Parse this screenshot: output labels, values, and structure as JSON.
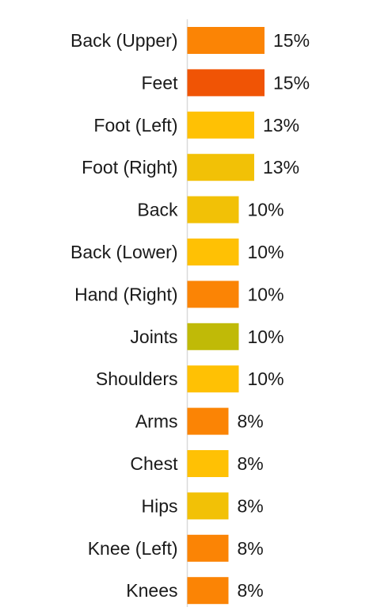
{
  "chart_data": {
    "type": "bar",
    "orientation": "horizontal",
    "categories": [
      "Back (Upper)",
      "Feet",
      "Foot (Left)",
      "Foot (Right)",
      "Back",
      "Back (Lower)",
      "Hand (Right)",
      "Joints",
      "Shoulders",
      "Arms",
      "Chest",
      "Hips",
      "Knee (Left)",
      "Knees"
    ],
    "values": [
      15,
      15,
      13,
      13,
      10,
      10,
      10,
      10,
      10,
      8,
      8,
      8,
      8,
      8
    ],
    "value_labels": [
      "15%",
      "15%",
      "13%",
      "13%",
      "10%",
      "10%",
      "10%",
      "10%",
      "10%",
      "8%",
      "8%",
      "8%",
      "8%",
      "8%"
    ],
    "bar_colors": [
      "#FB8405",
      "#F05405",
      "#FFC104",
      "#F2C106",
      "#F2C106",
      "#FFC104",
      "#FB8405",
      "#C0BA07",
      "#FFC104",
      "#FB8405",
      "#FFC104",
      "#F2C106",
      "#FB8405",
      "#FB8405"
    ],
    "value_unit": "%",
    "xlim": [
      0,
      15
    ],
    "title": "",
    "xlabel": "",
    "ylabel": "",
    "grid": false,
    "legend": "none"
  }
}
